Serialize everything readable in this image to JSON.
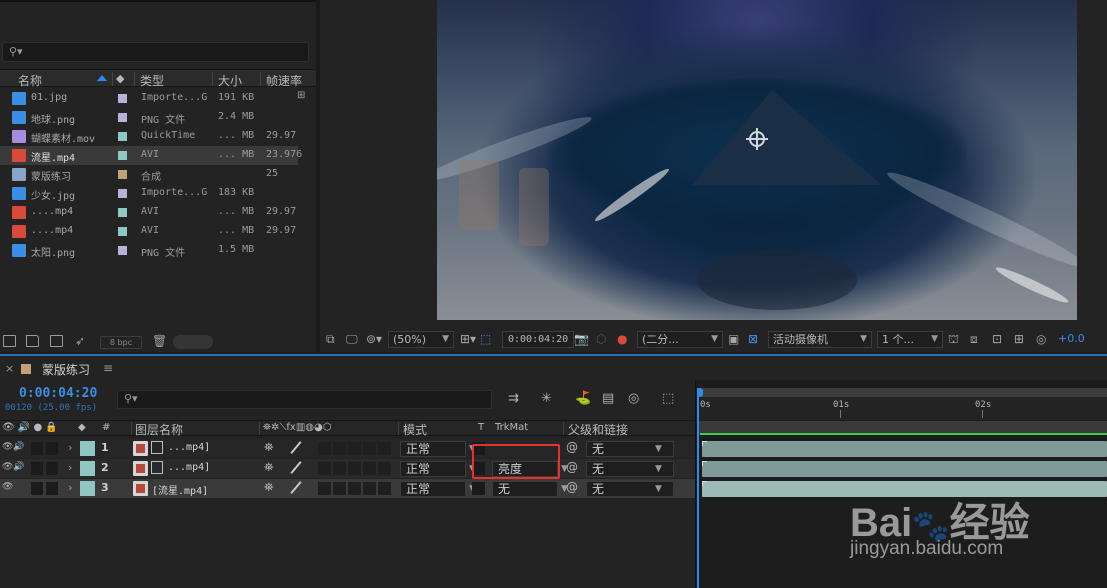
{
  "project": {
    "search_icon": "search-icon",
    "columns": {
      "name": "名称",
      "label": "",
      "type": "类型",
      "size": "大小",
      "fps": "帧速率"
    },
    "items": [
      {
        "name": "01.jpg",
        "type": "Importe...G",
        "size": "191 KB",
        "fps": "",
        "icon_color": "#3b8ee6",
        "label_color": "#b9b1d8"
      },
      {
        "name": "地球.png",
        "type": "PNG 文件",
        "size": "2.4 MB",
        "fps": "",
        "icon_color": "#3b8ee6",
        "label_color": "#b9b1d8"
      },
      {
        "name": "蝴蝶素材.mov",
        "type": "QuickTime",
        "size": "... MB",
        "fps": "29.97",
        "icon_color": "#a78be0",
        "label_color": "#8fc7c2"
      },
      {
        "name": "流星.mp4",
        "type": "AVI",
        "size": "... MB",
        "fps": "23.976",
        "icon_color": "#d84a3a",
        "label_color": "#8fc7c2",
        "selected": true
      },
      {
        "name": "蒙版练习",
        "type": "合成",
        "size": "",
        "fps": "25",
        "icon_color": "#8aa4c8",
        "label_color": "#c0a374"
      },
      {
        "name": "少女.jpg",
        "type": "Importe...G",
        "size": "183 KB",
        "fps": "",
        "icon_color": "#3b8ee6",
        "label_color": "#b9b1d8"
      },
      {
        "name": "....mp4",
        "type": "AVI",
        "size": "... MB",
        "fps": "29.97",
        "icon_color": "#d84a3a",
        "label_color": "#8fc7c2"
      },
      {
        "name": "....mp4",
        "type": "AVI",
        "size": "... MB",
        "fps": "29.97",
        "icon_color": "#d84a3a",
        "label_color": "#8fc7c2"
      },
      {
        "name": "太阳.png",
        "type": "PNG 文件",
        "size": "1.5 MB",
        "fps": "",
        "icon_color": "#3b8ee6",
        "label_color": "#b9b1d8"
      }
    ],
    "bpc": "8 bpc"
  },
  "viewer": {
    "zoom": "(50%)",
    "timecode": "0:00:04:20",
    "resolution": "(二分...",
    "camera": "活动摄像机",
    "views": "1 个...",
    "exposure": "+0.0"
  },
  "timeline": {
    "comp_name": "蒙版练习",
    "menu_icon": "≡",
    "current_time": "0:00:04:20",
    "frames": "00120 (25.00 fps)",
    "columns": {
      "num": "#",
      "layer_name": "图层名称",
      "mode": "模式",
      "t": "T",
      "trkmat": "TrkMat",
      "parent": "父级和链接"
    },
    "ruler": [
      "0s",
      "01s",
      "02s"
    ],
    "layers": [
      {
        "num": "1",
        "name": "...mp4]",
        "mode": "正常",
        "trkmat": "",
        "parent": "无",
        "label_color": "#8fc7c2"
      },
      {
        "num": "2",
        "name": "...mp4]",
        "mode": "正常",
        "trkmat": "亮度",
        "parent": "无",
        "label_color": "#8fc7c2"
      },
      {
        "num": "3",
        "name": "[流星.mp4]",
        "mode": "正常",
        "trkmat": "无",
        "parent": "无",
        "label_color": "#8fc7c2",
        "selected": true
      }
    ]
  },
  "watermark": {
    "brand": "Bai",
    "brand2": "经验",
    "url": "jingyan.baidu.com"
  },
  "colors": {
    "accent": "#2d8ceb",
    "timecode": "#3b8ee6",
    "highlight": "#e5322d",
    "track": "#7f9a97"
  }
}
